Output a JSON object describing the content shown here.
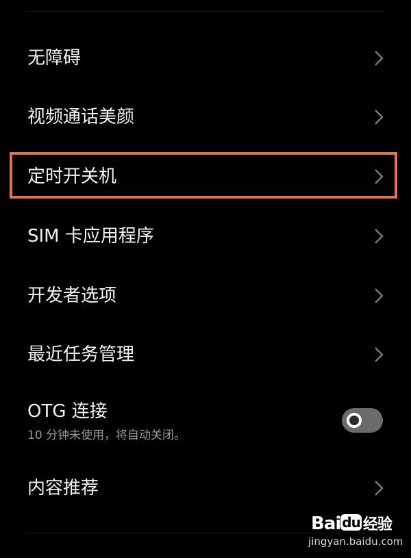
{
  "settings": {
    "items": [
      {
        "label": "无障碍"
      },
      {
        "label": "视频通话美颜"
      },
      {
        "label": "定时开关机"
      },
      {
        "label": "SIM 卡应用程序"
      },
      {
        "label": "开发者选项"
      },
      {
        "label": "最近任务管理"
      },
      {
        "label": "内容推荐"
      }
    ],
    "otg": {
      "label": "OTG 连接",
      "sublabel": "10 分钟未使用，将自动关闭。",
      "enabled": false
    }
  },
  "highlight_color": "#e2735a",
  "icons": {
    "chevron": "chevron-right-icon",
    "toggle": "toggle-switch"
  },
  "watermark": {
    "logo": "Bai",
    "logo_du": "du",
    "brand_cn": "经验",
    "url": "jingyan.baidu.com"
  }
}
